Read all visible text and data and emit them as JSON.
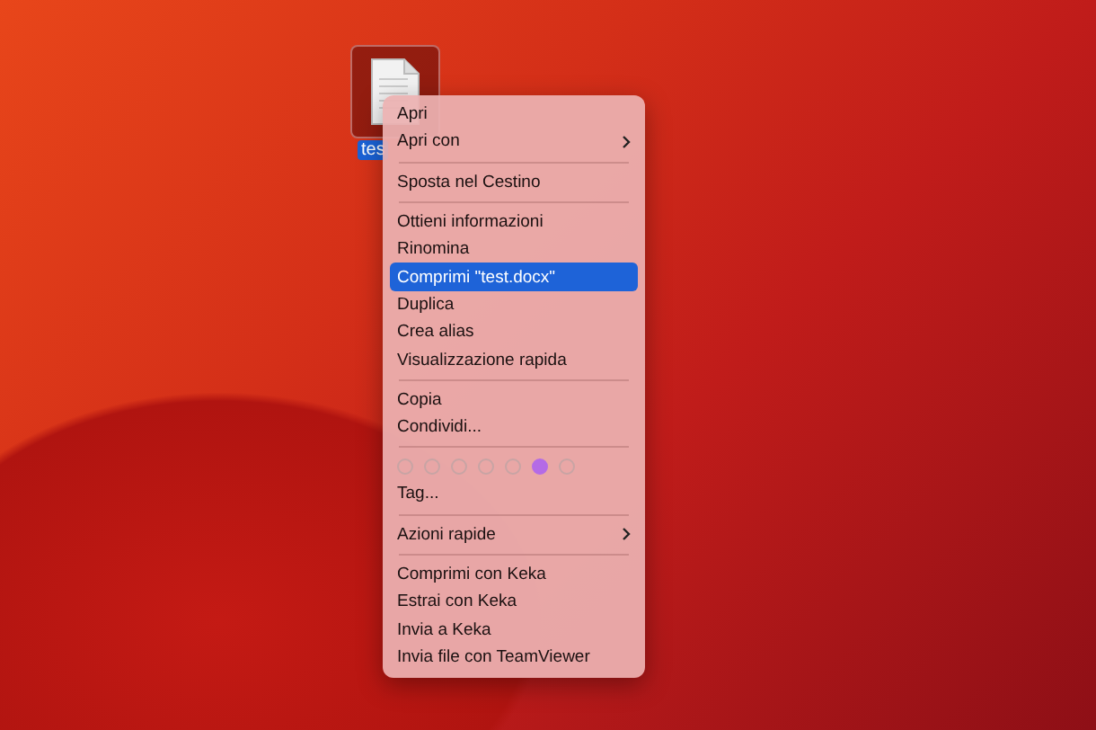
{
  "desktop_icon": {
    "label": "tes",
    "selected": true
  },
  "menu": [
    {
      "kind": "item",
      "label": "Apri",
      "selected": false,
      "submenu": false
    },
    {
      "kind": "item",
      "label": "Apri con",
      "selected": false,
      "submenu": true
    },
    {
      "kind": "separator"
    },
    {
      "kind": "item",
      "label": "Sposta nel Cestino",
      "selected": false,
      "submenu": false
    },
    {
      "kind": "separator"
    },
    {
      "kind": "item",
      "label": "Ottieni informazioni",
      "selected": false,
      "submenu": false
    },
    {
      "kind": "item",
      "label": "Rinomina",
      "selected": false,
      "submenu": false
    },
    {
      "kind": "item",
      "label": "Comprimi \"test.docx\"",
      "selected": true,
      "submenu": false
    },
    {
      "kind": "item",
      "label": "Duplica",
      "selected": false,
      "submenu": false
    },
    {
      "kind": "item",
      "label": "Crea alias",
      "selected": false,
      "submenu": false
    },
    {
      "kind": "item",
      "label": "Visualizzazione rapida",
      "selected": false,
      "submenu": false
    },
    {
      "kind": "separator"
    },
    {
      "kind": "item",
      "label": "Copia",
      "selected": false,
      "submenu": false
    },
    {
      "kind": "item",
      "label": "Condividi...",
      "selected": false,
      "submenu": false
    },
    {
      "kind": "separator"
    },
    {
      "kind": "tags",
      "tags": [
        {
          "color": "#c8a4a4",
          "selected": false
        },
        {
          "color": "#c8a4a4",
          "selected": false
        },
        {
          "color": "#c8a4a4",
          "selected": false
        },
        {
          "color": "#c8a4a4",
          "selected": false
        },
        {
          "color": "#c8a4a4",
          "selected": false
        },
        {
          "color": "#b46be6",
          "selected": true
        },
        {
          "color": "#c8a4a4",
          "selected": false
        }
      ]
    },
    {
      "kind": "item",
      "label": "Tag...",
      "selected": false,
      "submenu": false
    },
    {
      "kind": "separator"
    },
    {
      "kind": "item",
      "label": "Azioni rapide",
      "selected": false,
      "submenu": true
    },
    {
      "kind": "separator"
    },
    {
      "kind": "item",
      "label": "Comprimi con Keka",
      "selected": false,
      "submenu": false
    },
    {
      "kind": "item",
      "label": "Estrai con Keka",
      "selected": false,
      "submenu": false
    },
    {
      "kind": "item",
      "label": "Invia a Keka",
      "selected": false,
      "submenu": false
    },
    {
      "kind": "item",
      "label": "Invia file con TeamViewer",
      "selected": false,
      "submenu": false
    }
  ]
}
